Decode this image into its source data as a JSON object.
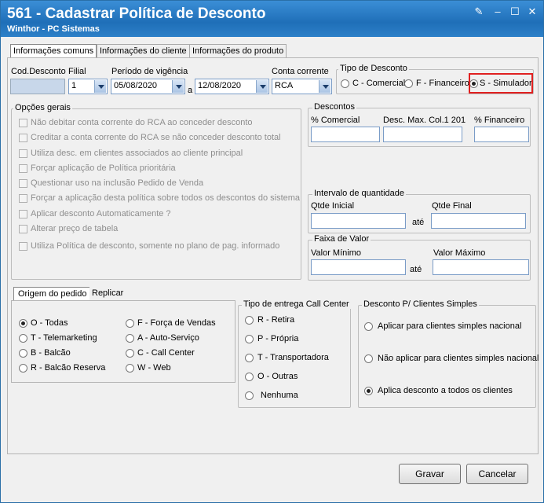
{
  "window": {
    "title": "561 - Cadastrar Política de Desconto",
    "subtitle": "Winthor - PC Sistemas"
  },
  "tabs": [
    "Informações comuns",
    "Informações do cliente",
    "Informações do produto"
  ],
  "fields": {
    "cod_label": "Cod.Desconto",
    "cod_value": "",
    "filial_label": "Filial",
    "filial_value": "1",
    "periodo_label": "Período de vigência",
    "data_inicio": "05/08/2020",
    "a_label": "a",
    "data_fim": "12/08/2020",
    "conta_label": "Conta corrente",
    "conta_value": "RCA"
  },
  "tipo_desconto": {
    "label": "Tipo de Desconto",
    "options": [
      "C - Comercial",
      "F - Financeiro",
      "S - Simulador"
    ],
    "selected": "S - Simulador"
  },
  "opcoes_gerais": {
    "label": "Opções gerais",
    "items": [
      "Não debitar conta corrente do RCA ao conceder desconto",
      "Creditar a conta corrente do RCA se não conceder desconto total",
      "Utiliza desc. em clientes associados ao cliente principal",
      "Forçar aplicação de Política prioritária",
      "Questionar uso na inclusão Pedido de Venda",
      "Forçar a aplicação desta política sobre todos os descontos do sistema",
      "Aplicar desconto Automaticamente ?",
      "Alterar preço de tabela",
      "Utiliza Política de desconto, somente no plano de pag. informado"
    ]
  },
  "descontos": {
    "label": "Descontos",
    "comercial": "% Comercial",
    "desc_max": "Desc. Max. Col.1 201",
    "financeiro": "% Financeiro"
  },
  "intervalo": {
    "label": "Intervalo de quantidade",
    "inicial": "Qtde Inicial",
    "ate": "até",
    "final": "Qtde Final"
  },
  "faixa": {
    "label": "Faixa de Valor",
    "minimo": "Valor Mínimo",
    "ate": "até",
    "maximo": "Valor Máximo"
  },
  "sub_tabs": [
    "Origem do pedido",
    "Replicar"
  ],
  "origem": {
    "left": [
      "O - Todas",
      "T - Telemarketing",
      "B - Balcão",
      "R - Balcão Reserva"
    ],
    "right": [
      "F - Força de Vendas",
      "A - Auto-Serviço",
      "C - Call Center",
      "W - Web"
    ],
    "selected": "O - Todas"
  },
  "entrega": {
    "label": "Tipo de entrega Call Center",
    "options": [
      "R - Retira",
      "P - Própria",
      "T - Transportadora",
      "O - Outras",
      "Nenhuma"
    ]
  },
  "simples": {
    "label": "Desconto P/ Clientes Simples",
    "options": [
      "Aplicar para clientes simples nacional",
      "Não aplicar para clientes simples nacional",
      "Aplica desconto a todos os clientes"
    ],
    "selected": "Aplica desconto a todos os clientes"
  },
  "buttons": {
    "gravar": "Gravar",
    "cancelar": "Cancelar"
  }
}
